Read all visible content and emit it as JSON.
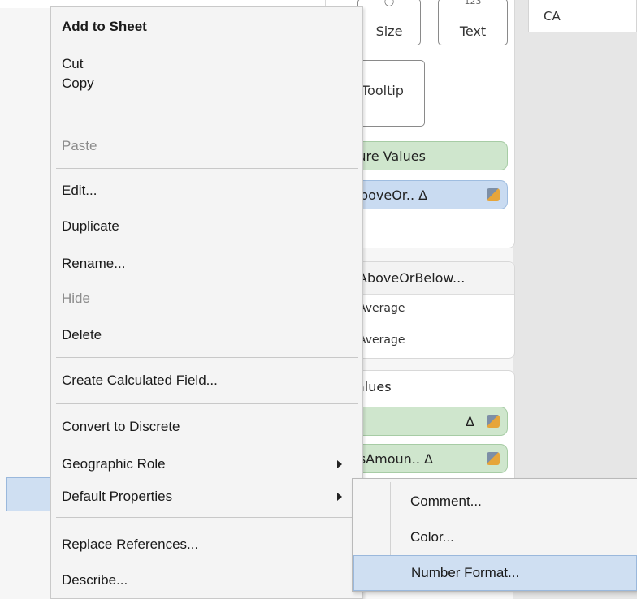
{
  "header": {
    "column_value": "CA"
  },
  "marks_card": {
    "size_label": "Size",
    "text_small": "123",
    "text_label": "Text",
    "tooltip_label": "Tooltip",
    "pills": [
      {
        "label": "sure Values",
        "color": "green"
      },
      {
        "label": "AboveOr.. Δ",
        "color": "blue"
      }
    ]
  },
  "legend": {
    "title": "AboveOrBelow...",
    "items": [
      "Average",
      "Average"
    ]
  },
  "values_card": {
    "title": "alues",
    "pills": [
      {
        "label": "Δ"
      },
      {
        "label": "esAmoun.. Δ"
      }
    ]
  },
  "context_menu": {
    "items": [
      {
        "label": "Add to Sheet",
        "bold": true
      },
      {
        "label": "Cut"
      },
      {
        "label": "Copy"
      },
      {
        "label": "Paste",
        "disabled": true
      },
      {
        "label": "Edit..."
      },
      {
        "label": "Duplicate"
      },
      {
        "label": "Rename..."
      },
      {
        "label": "Hide",
        "disabled": true
      },
      {
        "label": "Delete"
      },
      {
        "label": "Create Calculated Field..."
      },
      {
        "label": "Convert to Discrete"
      },
      {
        "label": "Geographic Role",
        "submenu": true
      },
      {
        "label": "Default Properties",
        "submenu": true,
        "highlighted": true
      },
      {
        "label": "Replace References..."
      },
      {
        "label": "Describe..."
      }
    ]
  },
  "submenu": {
    "items": [
      {
        "label": "Comment..."
      },
      {
        "label": "Color..."
      },
      {
        "label": "Number Format...",
        "selected": true
      }
    ]
  },
  "colors": {
    "highlight": "#cfdff2",
    "highlight_border": "#9ab8dc",
    "pill_green": "#cfe6cd",
    "pill_blue": "#c9dbf1"
  }
}
